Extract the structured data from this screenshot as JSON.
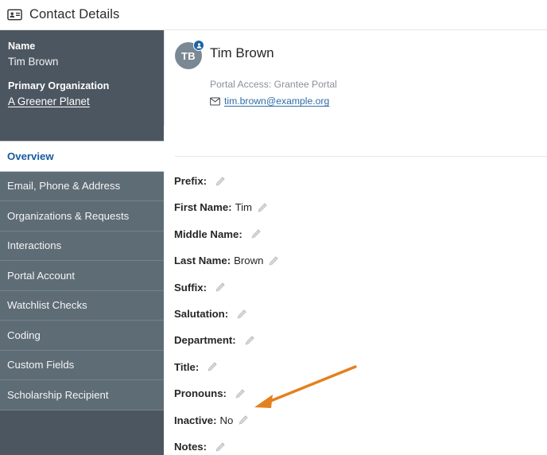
{
  "header": {
    "title": "Contact Details",
    "icon": "contact-card-icon"
  },
  "sidebar": {
    "summary": {
      "name_label": "Name",
      "name_value": "Tim Brown",
      "org_label": "Primary Organization",
      "org_value": "A Greener Planet"
    },
    "items": [
      {
        "label": "Overview",
        "active": true
      },
      {
        "label": "Email, Phone & Address",
        "active": false
      },
      {
        "label": "Organizations & Requests",
        "active": false
      },
      {
        "label": "Interactions",
        "active": false
      },
      {
        "label": "Portal Account",
        "active": false
      },
      {
        "label": "Watchlist Checks",
        "active": false
      },
      {
        "label": "Coding",
        "active": false
      },
      {
        "label": "Custom Fields",
        "active": false
      },
      {
        "label": "Scholarship Recipient",
        "active": false
      }
    ]
  },
  "contact_card": {
    "avatar_initials": "TB",
    "avatar_badge_icon": "person-badge-icon",
    "name": "Tim Brown",
    "portal_access": "Portal Access: Grantee Portal",
    "email_icon": "envelope-icon",
    "email": "tim.brown@example.org"
  },
  "fields": [
    {
      "label": "Prefix:",
      "value": "",
      "edit_icon": "pencil-icon"
    },
    {
      "label": "First Name:",
      "value": "Tim",
      "edit_icon": "pencil-icon"
    },
    {
      "label": "Middle Name:",
      "value": "",
      "edit_icon": "pencil-icon"
    },
    {
      "label": "Last Name:",
      "value": "Brown",
      "edit_icon": "pencil-icon"
    },
    {
      "label": "Suffix:",
      "value": "",
      "edit_icon": "pencil-icon"
    },
    {
      "label": "Salutation:",
      "value": "",
      "edit_icon": "pencil-icon"
    },
    {
      "label": "Department:",
      "value": "",
      "edit_icon": "pencil-icon"
    },
    {
      "label": "Title:",
      "value": "",
      "edit_icon": "pencil-icon"
    },
    {
      "label": "Pronouns:",
      "value": "",
      "edit_icon": "pencil-icon"
    },
    {
      "label": "Inactive:",
      "value": "No",
      "edit_icon": "pencil-icon"
    },
    {
      "label": "Notes:",
      "value": "",
      "edit_icon": "pencil-icon"
    }
  ],
  "annotation": {
    "type": "arrow",
    "color": "#e4801f",
    "points_at": "Inactive: No edit pencil"
  },
  "colors": {
    "sidebar_dark": "#4c5660",
    "sidebar_nav": "#5e6c75",
    "active_link": "#17599e",
    "link": "#2f6ca8",
    "badge_blue": "#1b63a5",
    "annotation_orange": "#e4801f"
  }
}
